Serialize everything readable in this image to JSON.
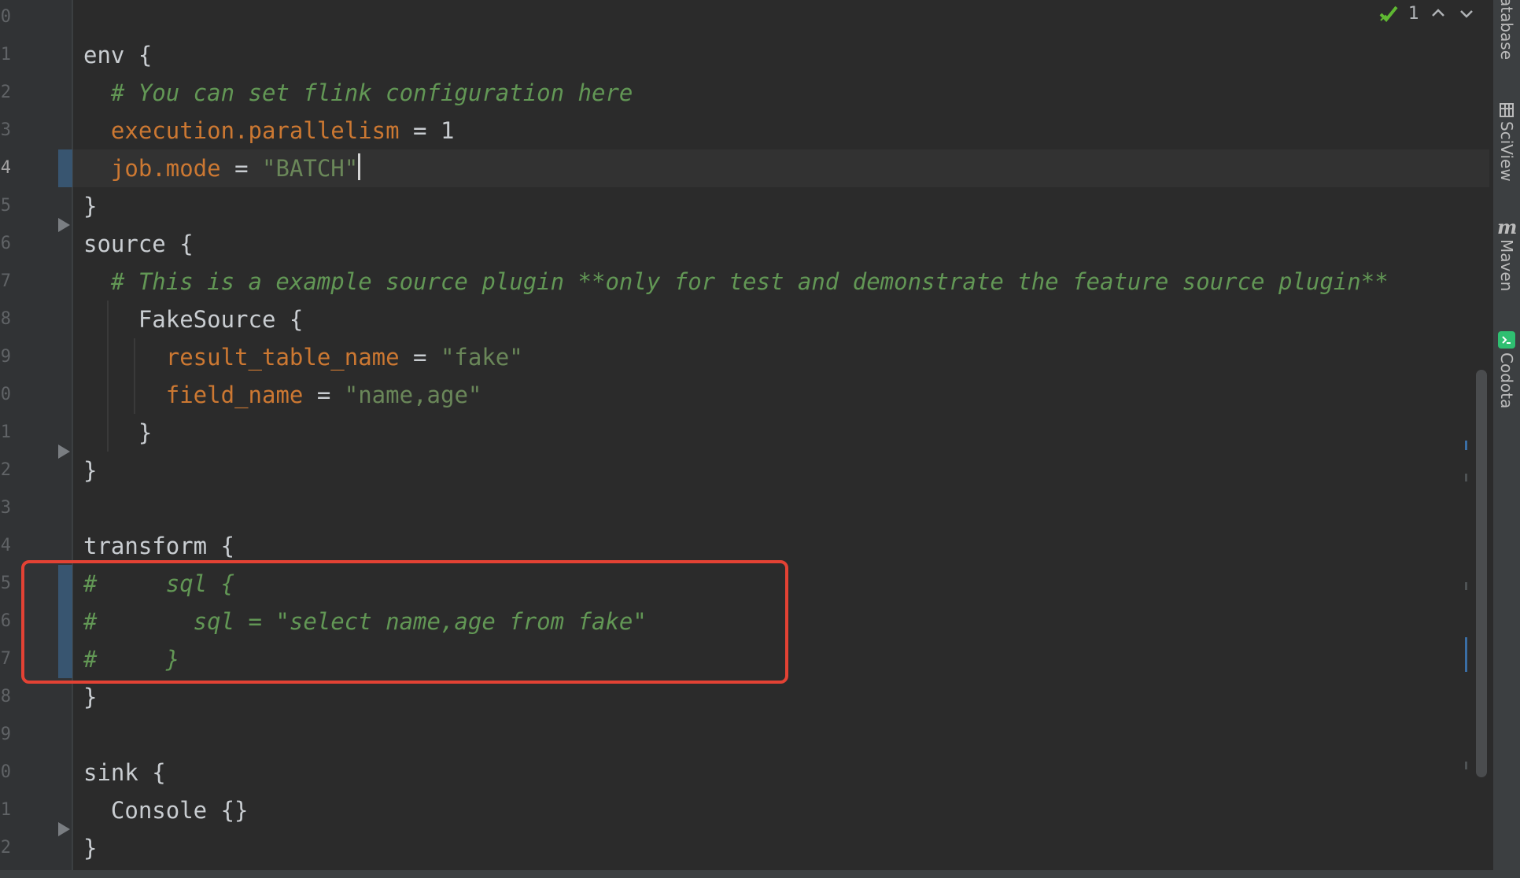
{
  "editor": {
    "line_numbers": [
      "0",
      "1",
      "2",
      "3",
      "4",
      "5",
      "6",
      "7",
      "8",
      "9",
      "0",
      "1",
      "2",
      "3",
      "4",
      "5",
      "6",
      "7",
      "8",
      "9",
      "0",
      "1",
      "2"
    ],
    "current_line_index": 4,
    "lines": [
      [
        {
          "t": "env {",
          "c": "ob"
        }
      ],
      [
        {
          "t": "  # You can set flink configuration here",
          "c": "comment"
        }
      ],
      [
        {
          "t": "  ",
          "c": "ob"
        },
        {
          "t": "execution.parallelism",
          "c": "key"
        },
        {
          "t": " = 1",
          "c": "ob"
        }
      ],
      [
        {
          "t": "  ",
          "c": "ob"
        },
        {
          "t": "job.mode",
          "c": "key"
        },
        {
          "t": " = ",
          "c": "ob"
        },
        {
          "t": "\"BATCH\"",
          "c": "str"
        },
        {
          "caret": true
        }
      ],
      [
        {
          "t": "}",
          "c": "ob"
        }
      ],
      [
        {
          "t": "source {",
          "c": "ob"
        }
      ],
      [
        {
          "t": "  # This is a example source plugin **only for test and demonstrate the feature source plugin**",
          "c": "comment"
        }
      ],
      [
        {
          "t": "    FakeSource {",
          "c": "ob"
        }
      ],
      [
        {
          "t": "      ",
          "c": "ob"
        },
        {
          "t": "result_table_name",
          "c": "key"
        },
        {
          "t": " = ",
          "c": "ob"
        },
        {
          "t": "\"fake\"",
          "c": "str"
        }
      ],
      [
        {
          "t": "      ",
          "c": "ob"
        },
        {
          "t": "field_name",
          "c": "key"
        },
        {
          "t": " = ",
          "c": "ob"
        },
        {
          "t": "\"name,age\"",
          "c": "str"
        }
      ],
      [
        {
          "t": "    }",
          "c": "ob"
        }
      ],
      [
        {
          "t": "}",
          "c": "ob"
        }
      ],
      [
        {
          "t": "",
          "c": "ob"
        }
      ],
      [
        {
          "t": "transform {",
          "c": "ob"
        }
      ],
      [
        {
          "t": "#     sql {",
          "c": "comment"
        }
      ],
      [
        {
          "t": "#       sql = \"select name,age from fake\"",
          "c": "comment"
        }
      ],
      [
        {
          "t": "#     }",
          "c": "comment"
        }
      ],
      [
        {
          "t": "}",
          "c": "ob"
        }
      ],
      [
        {
          "t": "",
          "c": "ob"
        }
      ],
      [
        {
          "t": "sink {",
          "c": "ob"
        }
      ],
      [
        {
          "t": "  Console {}",
          "c": "ob"
        }
      ],
      [
        {
          "t": "}",
          "c": "ob"
        }
      ]
    ]
  },
  "inspections": {
    "count": "1",
    "check_icon": "check-icon",
    "prev_icon": "chevron-up-icon",
    "next_icon": "chevron-down-icon"
  },
  "tool_windows": [
    {
      "label": "atabase",
      "icon": "database-icon"
    },
    {
      "label": "SciView",
      "icon": "sciview-icon"
    },
    {
      "label": "Maven",
      "icon": "maven-icon"
    },
    {
      "label": "Codota",
      "icon": "codota-icon"
    }
  ],
  "colors": {
    "background": "#2b2b2b",
    "comment": "#629755",
    "key": "#cc7832",
    "string": "#6a8759",
    "highlight_box": "#e34234"
  }
}
